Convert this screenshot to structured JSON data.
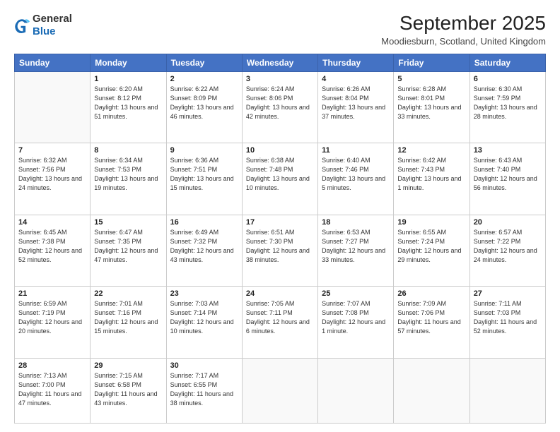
{
  "header": {
    "logo_line1": "General",
    "logo_line2": "Blue",
    "month": "September 2025",
    "location": "Moodiesburn, Scotland, United Kingdom"
  },
  "weekdays": [
    "Sunday",
    "Monday",
    "Tuesday",
    "Wednesday",
    "Thursday",
    "Friday",
    "Saturday"
  ],
  "weeks": [
    [
      {
        "day": "",
        "sunrise": "",
        "sunset": "",
        "daylight": ""
      },
      {
        "day": "1",
        "sunrise": "Sunrise: 6:20 AM",
        "sunset": "Sunset: 8:12 PM",
        "daylight": "Daylight: 13 hours and 51 minutes."
      },
      {
        "day": "2",
        "sunrise": "Sunrise: 6:22 AM",
        "sunset": "Sunset: 8:09 PM",
        "daylight": "Daylight: 13 hours and 46 minutes."
      },
      {
        "day": "3",
        "sunrise": "Sunrise: 6:24 AM",
        "sunset": "Sunset: 8:06 PM",
        "daylight": "Daylight: 13 hours and 42 minutes."
      },
      {
        "day": "4",
        "sunrise": "Sunrise: 6:26 AM",
        "sunset": "Sunset: 8:04 PM",
        "daylight": "Daylight: 13 hours and 37 minutes."
      },
      {
        "day": "5",
        "sunrise": "Sunrise: 6:28 AM",
        "sunset": "Sunset: 8:01 PM",
        "daylight": "Daylight: 13 hours and 33 minutes."
      },
      {
        "day": "6",
        "sunrise": "Sunrise: 6:30 AM",
        "sunset": "Sunset: 7:59 PM",
        "daylight": "Daylight: 13 hours and 28 minutes."
      }
    ],
    [
      {
        "day": "7",
        "sunrise": "Sunrise: 6:32 AM",
        "sunset": "Sunset: 7:56 PM",
        "daylight": "Daylight: 13 hours and 24 minutes."
      },
      {
        "day": "8",
        "sunrise": "Sunrise: 6:34 AM",
        "sunset": "Sunset: 7:53 PM",
        "daylight": "Daylight: 13 hours and 19 minutes."
      },
      {
        "day": "9",
        "sunrise": "Sunrise: 6:36 AM",
        "sunset": "Sunset: 7:51 PM",
        "daylight": "Daylight: 13 hours and 15 minutes."
      },
      {
        "day": "10",
        "sunrise": "Sunrise: 6:38 AM",
        "sunset": "Sunset: 7:48 PM",
        "daylight": "Daylight: 13 hours and 10 minutes."
      },
      {
        "day": "11",
        "sunrise": "Sunrise: 6:40 AM",
        "sunset": "Sunset: 7:46 PM",
        "daylight": "Daylight: 13 hours and 5 minutes."
      },
      {
        "day": "12",
        "sunrise": "Sunrise: 6:42 AM",
        "sunset": "Sunset: 7:43 PM",
        "daylight": "Daylight: 13 hours and 1 minute."
      },
      {
        "day": "13",
        "sunrise": "Sunrise: 6:43 AM",
        "sunset": "Sunset: 7:40 PM",
        "daylight": "Daylight: 12 hours and 56 minutes."
      }
    ],
    [
      {
        "day": "14",
        "sunrise": "Sunrise: 6:45 AM",
        "sunset": "Sunset: 7:38 PM",
        "daylight": "Daylight: 12 hours and 52 minutes."
      },
      {
        "day": "15",
        "sunrise": "Sunrise: 6:47 AM",
        "sunset": "Sunset: 7:35 PM",
        "daylight": "Daylight: 12 hours and 47 minutes."
      },
      {
        "day": "16",
        "sunrise": "Sunrise: 6:49 AM",
        "sunset": "Sunset: 7:32 PM",
        "daylight": "Daylight: 12 hours and 43 minutes."
      },
      {
        "day": "17",
        "sunrise": "Sunrise: 6:51 AM",
        "sunset": "Sunset: 7:30 PM",
        "daylight": "Daylight: 12 hours and 38 minutes."
      },
      {
        "day": "18",
        "sunrise": "Sunrise: 6:53 AM",
        "sunset": "Sunset: 7:27 PM",
        "daylight": "Daylight: 12 hours and 33 minutes."
      },
      {
        "day": "19",
        "sunrise": "Sunrise: 6:55 AM",
        "sunset": "Sunset: 7:24 PM",
        "daylight": "Daylight: 12 hours and 29 minutes."
      },
      {
        "day": "20",
        "sunrise": "Sunrise: 6:57 AM",
        "sunset": "Sunset: 7:22 PM",
        "daylight": "Daylight: 12 hours and 24 minutes."
      }
    ],
    [
      {
        "day": "21",
        "sunrise": "Sunrise: 6:59 AM",
        "sunset": "Sunset: 7:19 PM",
        "daylight": "Daylight: 12 hours and 20 minutes."
      },
      {
        "day": "22",
        "sunrise": "Sunrise: 7:01 AM",
        "sunset": "Sunset: 7:16 PM",
        "daylight": "Daylight: 12 hours and 15 minutes."
      },
      {
        "day": "23",
        "sunrise": "Sunrise: 7:03 AM",
        "sunset": "Sunset: 7:14 PM",
        "daylight": "Daylight: 12 hours and 10 minutes."
      },
      {
        "day": "24",
        "sunrise": "Sunrise: 7:05 AM",
        "sunset": "Sunset: 7:11 PM",
        "daylight": "Daylight: 12 hours and 6 minutes."
      },
      {
        "day": "25",
        "sunrise": "Sunrise: 7:07 AM",
        "sunset": "Sunset: 7:08 PM",
        "daylight": "Daylight: 12 hours and 1 minute."
      },
      {
        "day": "26",
        "sunrise": "Sunrise: 7:09 AM",
        "sunset": "Sunset: 7:06 PM",
        "daylight": "Daylight: 11 hours and 57 minutes."
      },
      {
        "day": "27",
        "sunrise": "Sunrise: 7:11 AM",
        "sunset": "Sunset: 7:03 PM",
        "daylight": "Daylight: 11 hours and 52 minutes."
      }
    ],
    [
      {
        "day": "28",
        "sunrise": "Sunrise: 7:13 AM",
        "sunset": "Sunset: 7:00 PM",
        "daylight": "Daylight: 11 hours and 47 minutes."
      },
      {
        "day": "29",
        "sunrise": "Sunrise: 7:15 AM",
        "sunset": "Sunset: 6:58 PM",
        "daylight": "Daylight: 11 hours and 43 minutes."
      },
      {
        "day": "30",
        "sunrise": "Sunrise: 7:17 AM",
        "sunset": "Sunset: 6:55 PM",
        "daylight": "Daylight: 11 hours and 38 minutes."
      },
      {
        "day": "",
        "sunrise": "",
        "sunset": "",
        "daylight": ""
      },
      {
        "day": "",
        "sunrise": "",
        "sunset": "",
        "daylight": ""
      },
      {
        "day": "",
        "sunrise": "",
        "sunset": "",
        "daylight": ""
      },
      {
        "day": "",
        "sunrise": "",
        "sunset": "",
        "daylight": ""
      }
    ]
  ]
}
